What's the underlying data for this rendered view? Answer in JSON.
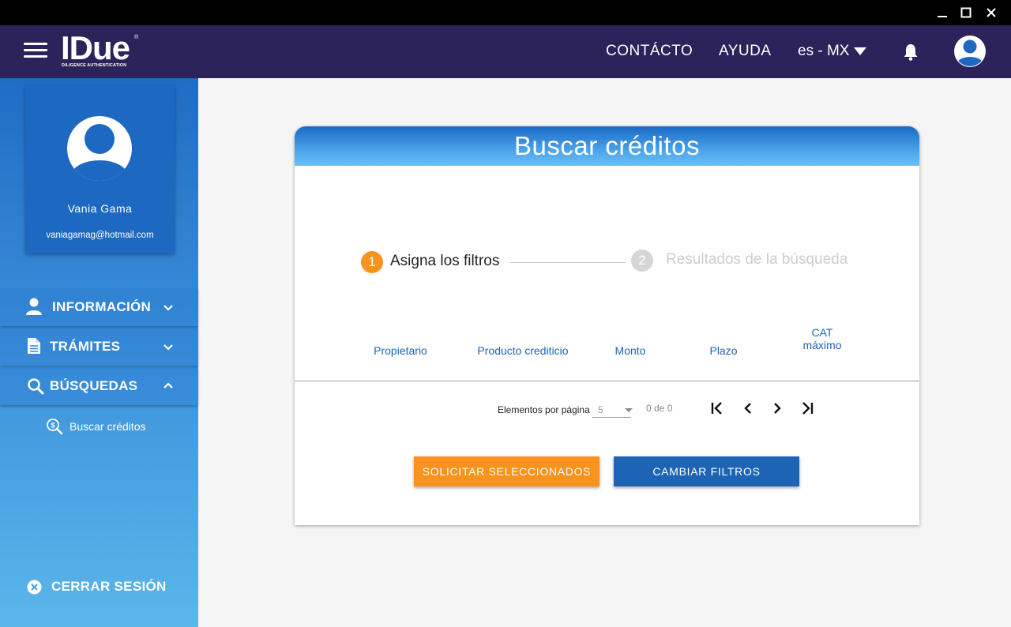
{
  "window": {
    "minimize_label": "minimize",
    "maximize_label": "maximize",
    "close_label": "close"
  },
  "header": {
    "logo_text": "IDue",
    "logo_reg": "®",
    "logo_subtitle": "DILIGENCE AUTHENTICATION",
    "nav": {
      "contact": "CONTÁCTO",
      "help": "AYUDA"
    },
    "language": "es - MX",
    "colors": {
      "background": "#2b2359"
    }
  },
  "profile": {
    "name": "Vania Gama",
    "email": "vaniagamag@hotmail.com"
  },
  "sidebar": {
    "menu": [
      {
        "label": "INFORMACIÓN",
        "icon": "user-icon",
        "expanded": false
      },
      {
        "label": "TRÁMITES",
        "icon": "document-icon",
        "expanded": false
      },
      {
        "label": "BÚSQUEDAS",
        "icon": "search-icon",
        "expanded": true
      }
    ],
    "submenu": [
      {
        "label": "Buscar créditos",
        "icon": "search-dollar-icon"
      }
    ],
    "logout": "CERRAR SESIÓN"
  },
  "main": {
    "title": "Buscar créditos",
    "steps": [
      {
        "number": "1",
        "label": "Asigna los filtros",
        "active": true,
        "color": "#f7931e"
      },
      {
        "number": "2",
        "label": "Resultados de la búsqueda",
        "active": false,
        "color": "#d6d6d6"
      }
    ],
    "table": {
      "columns": [
        "Propietario",
        "Producto crediticio",
        "Monto",
        "Plazo",
        "CAT máximo"
      ],
      "rows": []
    },
    "pagination": {
      "items_per_page_label": "Elementos por página",
      "items_per_page": "5",
      "range": "0 de 0"
    },
    "buttons": {
      "request_selected": "SOLICITAR SELECCIONADOS",
      "change_filters": "CAMBIAR FILTROS"
    },
    "colors": {
      "orange": "#f7931e",
      "blue": "#1e64b4"
    }
  }
}
